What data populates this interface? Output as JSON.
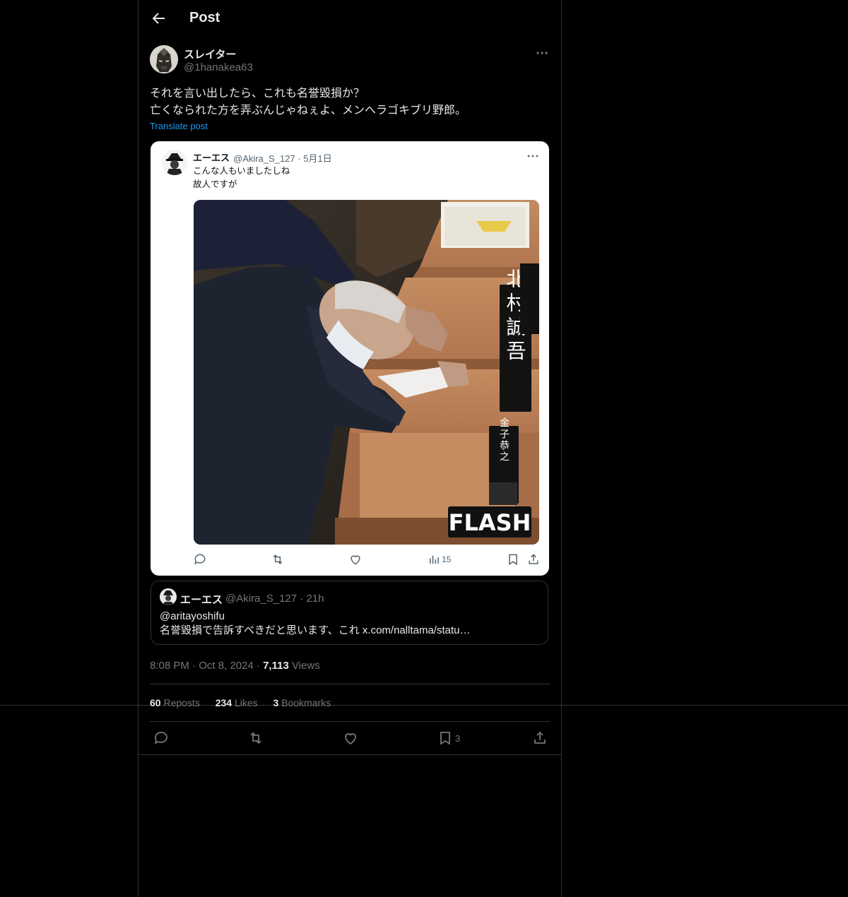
{
  "header": {
    "title": "Post"
  },
  "author": {
    "name": "スレイター",
    "handle": "@1hanakea63"
  },
  "post": {
    "lines": [
      "それを言い出したら、これも名誉毀損か？",
      "亡くなられた方を弄ぶんじゃねぇよ、メンヘラゴキブリ野郎。"
    ],
    "translate_label": "Translate post",
    "timestamp": "8:08 PM · Oct 8, 2024 · ",
    "views_count": "7,113",
    "views_label": " Views"
  },
  "embedded": {
    "name": "エーエス",
    "handle_date": "@Akira_S_127 · 5月1日",
    "lines": [
      "こんな人もいましたしね",
      "故人ですが"
    ],
    "photo": {
      "nameplate_main": "北村誠吾",
      "nameplate_small": "金子恭之",
      "watermark": "FLASH"
    },
    "views": "15"
  },
  "quoted": {
    "name": "エーエス",
    "handle_time": "@Akira_S_127 · 21h",
    "line1": "@aritayoshifu",
    "line2": "名誉毀損で告訴すべきだと思います、これ x.com/nalltama/statu…"
  },
  "stats": {
    "reposts_count": "60",
    "reposts_label": " Reposts",
    "likes_count": "234",
    "likes_label": " Likes",
    "bookmarks_count": "3",
    "bookmarks_label": " Bookmarks"
  },
  "actions": {
    "bookmark_count": "3"
  },
  "colors": {
    "accent": "#1d9bf0",
    "background": "#000000",
    "secondary_text": "#71767b",
    "border": "#2f3336"
  }
}
